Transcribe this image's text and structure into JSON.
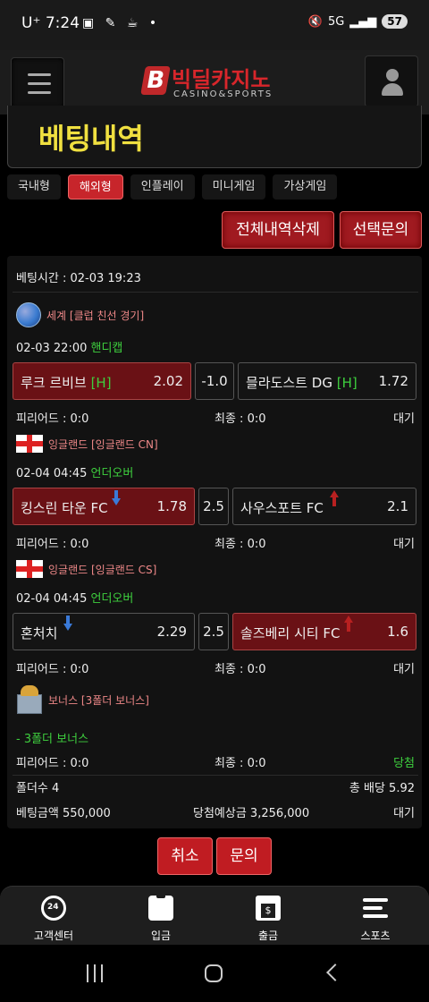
{
  "status_bar": {
    "carrier": "U⁺",
    "time": "7:24",
    "network": "5G",
    "battery": "57"
  },
  "header": {
    "logo_letter": "B",
    "logo_text": "빅딜카지노",
    "logo_sub": "CASINO&SPORTS"
  },
  "page_title": "베팅내역",
  "tabs": [
    "국내형",
    "해외형",
    "인플레이",
    "미니게임",
    "가상게임"
  ],
  "active_tab": "해외형",
  "buttons": {
    "delete_all": "전체내역삭제",
    "inquiry_selected": "선택문의",
    "cancel": "취소",
    "inquiry": "문의"
  },
  "bet": {
    "time_label": "베팅시간 : 02-03 19:23",
    "matches": [
      {
        "league": "세계 [클럽 친선 경기]",
        "icon": "globe-icon",
        "datetime": "02-03 22:00",
        "bet_type": "핸디캡",
        "home": "루크 르비브",
        "home_tag": "[H]",
        "home_odds": "2.02",
        "line": "-1.0",
        "away": "믈라도스트 DG",
        "away_tag": "[H]",
        "away_odds": "1.72",
        "selected": "home",
        "period_score": "피리어드 : 0:0",
        "final_score": "최종 : 0:0",
        "status": "대기"
      },
      {
        "league": "잉글랜드 [잉글랜드 CN]",
        "icon": "england-flag-icon",
        "datetime": "02-04 04:45",
        "bet_type": "언더오버",
        "home": "킹스린 타운 FC",
        "home_odds": "1.78",
        "line": "2.5",
        "away": "사우스포트 FC",
        "away_odds": "2.1",
        "selected": "home",
        "period_score": "피리어드 : 0:0",
        "final_score": "최종 : 0:0",
        "status": "대기"
      },
      {
        "league": "잉글랜드 [잉글랜드 CS]",
        "icon": "england-flag-icon",
        "datetime": "02-04 04:45",
        "bet_type": "언더오버",
        "home": "혼처치",
        "home_odds": "2.29",
        "line": "2.5",
        "away": "솔즈베리 시티 FC",
        "away_odds": "1.6",
        "selected": "away",
        "period_score": "피리어드 : 0:0",
        "final_score": "최종 : 0:0",
        "status": "대기"
      }
    ],
    "bonus": {
      "league": "보너스 [3폴더 보너스]",
      "icon": "gift-icon",
      "name": "- 3폴더 보너스",
      "period_score": "피리어드 : 0:0",
      "final_score": "최종 : 0:0",
      "status": "당첨"
    },
    "folder_count": "폴더수 4",
    "total_odds": "총 배당 5.92",
    "bet_amount": "베팅금액 550,000",
    "expected_win": "당첨예상금 3,256,000",
    "status": "대기"
  },
  "bottom_nav": [
    {
      "label": "고객센터",
      "icon": "support-24-icon"
    },
    {
      "label": "입금",
      "icon": "wallet-icon"
    },
    {
      "label": "출금",
      "icon": "atm-withdraw-icon"
    },
    {
      "label": "스포츠",
      "icon": "list-icon"
    }
  ],
  "colors": {
    "accent_red": "#c7252b",
    "title_yellow": "#f0e040",
    "green": "#3ecf3e"
  }
}
